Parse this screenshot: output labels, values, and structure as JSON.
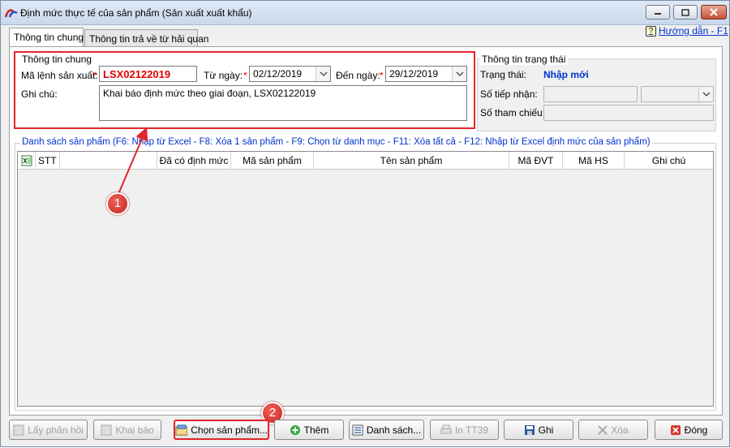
{
  "window": {
    "title": "Định mức thực tế của sản phẩm (Sản xuất xuất khẩu)"
  },
  "tabs": [
    {
      "label": "Thông tin chung",
      "active": true
    },
    {
      "label": "Thông tin trả về từ hải quan",
      "active": false
    }
  ],
  "help": {
    "label": "Hướng dẫn - F1"
  },
  "general": {
    "group_title": "Thông tin chung",
    "order_label": "Mã lệnh sản xuất:",
    "order_value": "LSX02122019",
    "from_label": "Từ ngày:",
    "from_value": "02/12/2019",
    "to_label": "Đến ngày:",
    "to_value": "29/12/2019",
    "note_label": "Ghi chú:",
    "note_value": "Khai báo định mức theo giai đoạn, LSX02122019",
    "required_mark": "*"
  },
  "status": {
    "group_title": "Thông tin trạng thái",
    "state_label": "Trạng thái:",
    "state_value": "Nhập mới",
    "receipt_label": "Số tiếp nhận:",
    "ref_label": "Số tham chiếu:"
  },
  "products": {
    "header": "Danh sách sản phẩm (F6: Nhập từ Excel - F8: Xóa 1 sản phẩm - F9: Chọn từ danh mục - F11: Xóa tất cả - F12: Nhập từ Excel định mức của sản phẩm)",
    "columns": [
      "STT",
      "Đã có định mức",
      "Mã sản phẩm",
      "Tên sản phẩm",
      "Mã ĐVT",
      "Mã HS",
      "Ghi chú"
    ]
  },
  "buttons": {
    "get_response": "Lấy phản hồi",
    "declare": "Khai báo",
    "choose_product": "Chọn sản phẩm...",
    "add": "Thêm",
    "list": "Danh sách...",
    "print": "In TT39",
    "save": "Ghi",
    "delete": "Xóa",
    "close": "Đóng"
  },
  "annotations": {
    "badge1": "1",
    "badge2": "2"
  },
  "colors": {
    "accent_red": "#e0252b",
    "status_blue": "#0033cc",
    "required": "#e00000"
  }
}
